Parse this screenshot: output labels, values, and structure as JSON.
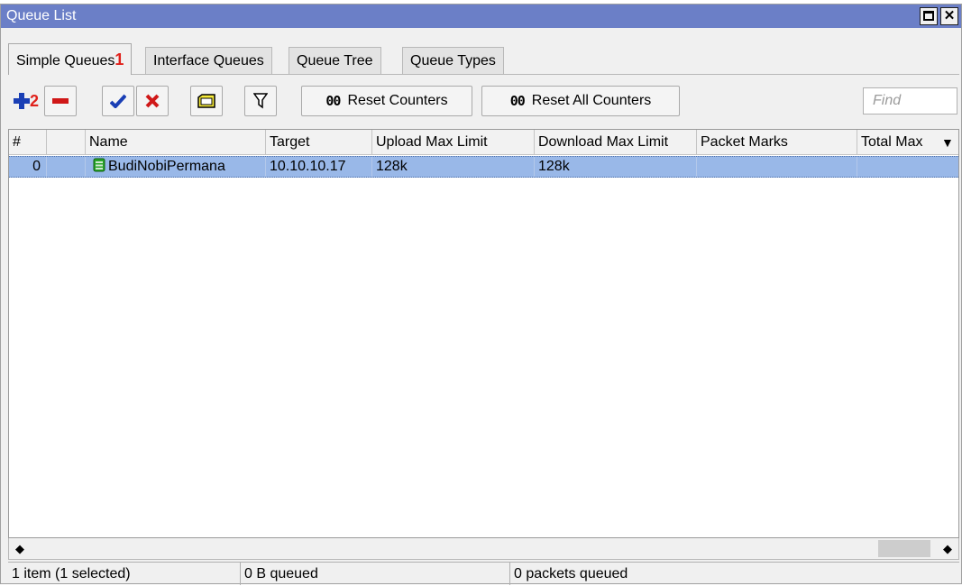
{
  "window": {
    "title": "Queue List",
    "maximize_icon": "maximize-icon",
    "close_label": "✕"
  },
  "tabs": [
    {
      "label": "Simple Queues",
      "annotation": "1",
      "active": true
    },
    {
      "label": "Interface Queues",
      "active": false
    },
    {
      "label": "Queue Tree",
      "active": false
    },
    {
      "label": "Queue Types",
      "active": false
    }
  ],
  "toolbar": {
    "add_icon": "plus-icon",
    "add_annotation": "2",
    "remove_icon": "minus-icon",
    "enable_icon": "checkmark-icon",
    "disable_icon": "cross-icon",
    "comment_icon": "comment-icon",
    "filter_icon": "filter-icon",
    "reset_counters_prefix": "00",
    "reset_counters_label": "Reset Counters",
    "reset_all_prefix": "00",
    "reset_all_label": "Reset All Counters",
    "find_placeholder": "Find"
  },
  "table": {
    "columns": [
      "#",
      "",
      "Name",
      "Target",
      "Upload Max Limit",
      "Download Max Limit",
      "Packet Marks",
      "Total Max"
    ],
    "sort_icon": "▼",
    "rows": [
      {
        "num": "0",
        "flag": "",
        "name": "BudiNobiPermana",
        "target": "10.10.10.17",
        "upload": "128k",
        "download": "128k",
        "packet_marks": "",
        "total_max": "",
        "selected": true
      }
    ]
  },
  "scrollbar": {
    "left_arrow": "◆",
    "right_arrow": "◆"
  },
  "status": {
    "items": "1 item (1 selected)",
    "queued": "0 B queued",
    "packets": "0 packets queued"
  },
  "colors": {
    "titlebar": "#6b7fc7",
    "selection": "#99b8e8",
    "annotation": "#e0211b",
    "add_icon": "#1a3fb5",
    "remove_icon": "#d01818",
    "check_icon": "#1a3fb5",
    "x_icon": "#d01818",
    "queue_icon": "#2aa52a"
  }
}
